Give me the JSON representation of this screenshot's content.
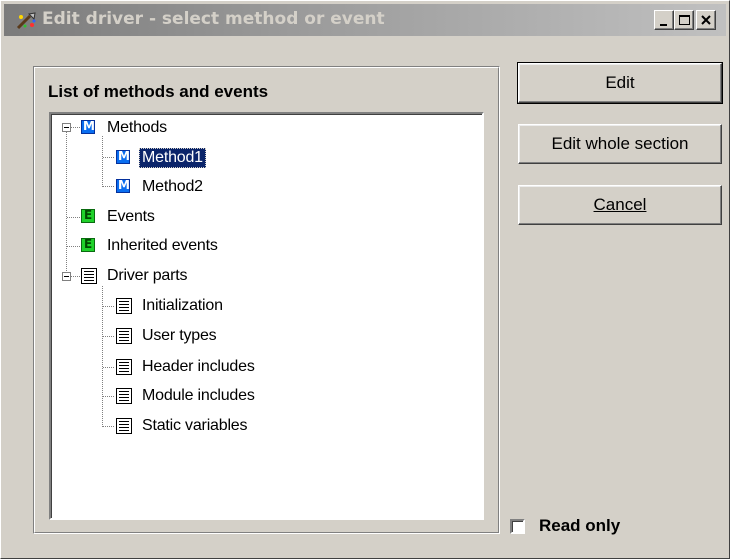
{
  "window": {
    "title": "Edit driver - select method or event",
    "controls": [
      "minimize-icon",
      "maximize-icon",
      "close-icon"
    ]
  },
  "panel": {
    "title": "List of methods and events"
  },
  "tree": {
    "nodes": [
      {
        "label": "Methods",
        "icon": "method-icon",
        "expanded": true
      },
      {
        "label": "Method1",
        "icon": "method-icon",
        "selected": true
      },
      {
        "label": "Method2",
        "icon": "method-icon"
      },
      {
        "label": "Events",
        "icon": "event-icon"
      },
      {
        "label": "Inherited events",
        "icon": "event-icon"
      },
      {
        "label": "Driver parts",
        "icon": "document-icon",
        "expanded": true
      },
      {
        "label": "Initialization",
        "icon": "document-icon"
      },
      {
        "label": "User types",
        "icon": "document-icon"
      },
      {
        "label": "Header includes",
        "icon": "document-icon"
      },
      {
        "label": "Module includes",
        "icon": "document-icon"
      },
      {
        "label": "Static variables",
        "icon": "document-icon"
      }
    ]
  },
  "buttons": {
    "edit": "Edit",
    "edit_whole_section": "Edit whole section",
    "cancel": "Cancel"
  },
  "read_only": {
    "label": "Read only",
    "checked": false
  },
  "colors": {
    "face": "#d4d0c8",
    "selection": "#0a246a",
    "method_icon": "#0a6ef0",
    "event_icon": "#1fd12a"
  }
}
